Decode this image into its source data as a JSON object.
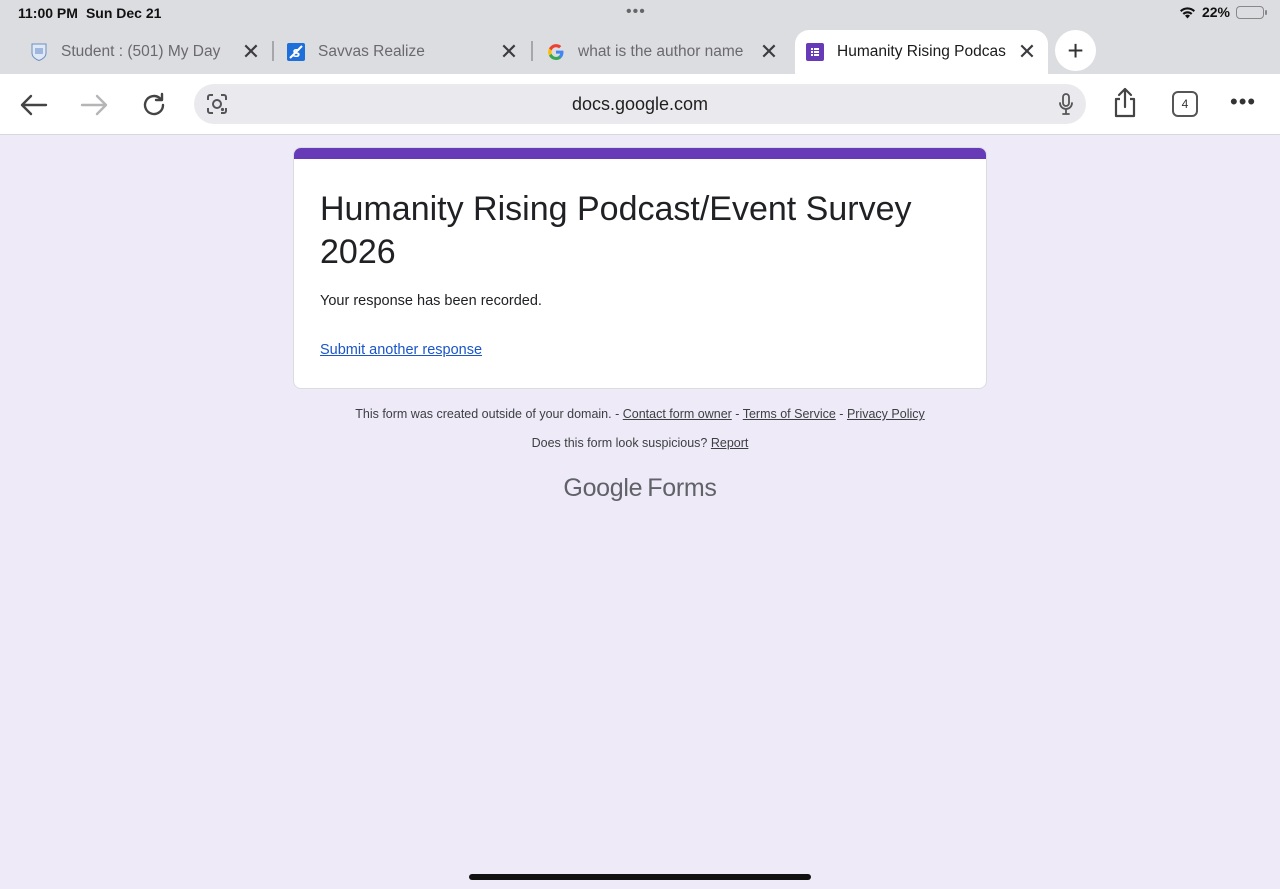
{
  "status": {
    "time": "11:00 PM",
    "date": "Sun Dec 21",
    "battery_percent": "22%",
    "battery_level": 0.22,
    "center_dots": "•••"
  },
  "tabs": [
    {
      "label": "Student : (501) My Day",
      "favicon": "school-crest-icon",
      "active": false
    },
    {
      "label": "Savvas Realize",
      "favicon": "savvas-s-icon",
      "active": false
    },
    {
      "label": "what is the author name",
      "favicon": "google-g-icon",
      "active": false
    },
    {
      "label": "Humanity Rising Podcas",
      "favicon": "google-forms-icon",
      "active": true
    }
  ],
  "new_tab_label": "+",
  "toolbar": {
    "url": "docs.google.com",
    "tab_count": "4",
    "more": "•••"
  },
  "form": {
    "accent_color": "#673ab7",
    "title": "Humanity Rising Podcast/Event Survey 2026",
    "confirmation": "Your response has been recorded.",
    "submit_another": "Submit another response"
  },
  "footer": {
    "created_outside": "This form was created outside of your domain. -",
    "contact_owner": "Contact form owner",
    "sep1": "-",
    "terms": "Terms of Service",
    "sep2": "-",
    "privacy": "Privacy Policy",
    "suspicious": "Does this form look suspicious?",
    "report": "Report"
  },
  "brand": {
    "google": "Google",
    "forms": "Forms"
  }
}
